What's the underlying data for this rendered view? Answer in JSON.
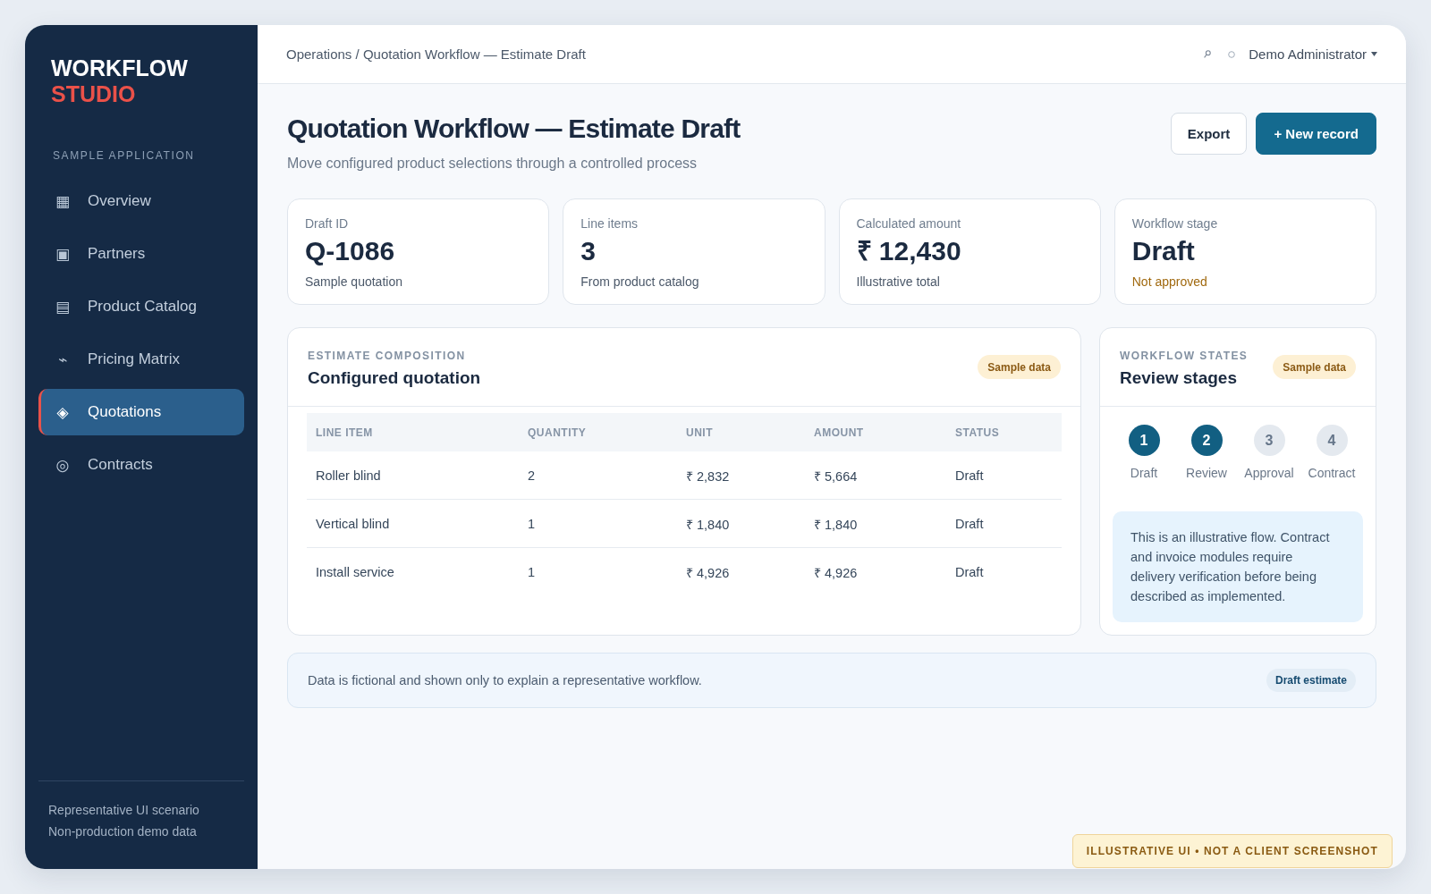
{
  "sidebar": {
    "logo": {
      "primary": "WORKFLOW",
      "accent": "STUDIO"
    },
    "section_label": "SAMPLE APPLICATION",
    "items": [
      {
        "icon": "▦",
        "label": "Overview",
        "selected": false
      },
      {
        "icon": "▣",
        "label": "Partners",
        "selected": false
      },
      {
        "icon": "▤",
        "label": "Product Catalog",
        "selected": false
      },
      {
        "icon": "⌁",
        "label": "Pricing Matrix",
        "selected": false
      },
      {
        "icon": "◈",
        "label": "Quotations",
        "selected": true
      },
      {
        "icon": "◎",
        "label": "Contracts",
        "selected": false
      }
    ],
    "footer": [
      "Representative UI scenario",
      "Non-production demo data"
    ]
  },
  "topbar": {
    "breadcrumb": "Operations / Quotation Workflow — Estimate Draft",
    "user": "Demo Administrator"
  },
  "header": {
    "title": "Quotation Workflow — Estimate Draft",
    "subtitle": "Move configured product selections through a controlled process",
    "buttons": [
      {
        "label": "Export",
        "kind": "secondary"
      },
      {
        "label": "+ New record",
        "kind": "primary"
      }
    ]
  },
  "stats": [
    {
      "label": "Draft ID",
      "value": "Q-1086",
      "note": "Sample quotation",
      "warning": false
    },
    {
      "label": "Line items",
      "value": "3",
      "note": "From product catalog",
      "warning": false
    },
    {
      "label": "Calculated amount",
      "value": "₹ 12,430",
      "note": "Illustrative total",
      "warning": false
    },
    {
      "label": "Workflow stage",
      "value": "Draft",
      "note": "Not approved",
      "warning": true
    }
  ],
  "estimate": {
    "eyebrow": "ESTIMATE COMPOSITION",
    "title": "Configured quotation",
    "badge": "Sample data",
    "table": {
      "columns": [
        "LINE ITEM",
        "QUANTITY",
        "UNIT",
        "AMOUNT",
        "STATUS"
      ],
      "rows": [
        [
          "Roller blind",
          "2",
          "₹ 2,832",
          "₹ 5,664",
          "Draft"
        ],
        [
          "Vertical blind",
          "1",
          "₹ 1,840",
          "₹ 1,840",
          "Draft"
        ],
        [
          "Install service",
          "1",
          "₹ 4,926",
          "₹ 4,926",
          "Draft"
        ]
      ]
    }
  },
  "workflow": {
    "eyebrow": "WORKFLOW STATES",
    "title": "Review stages",
    "badge": "Sample data",
    "steps": [
      {
        "number": "1",
        "label": "Draft",
        "active": true
      },
      {
        "number": "2",
        "label": "Review",
        "active": true
      },
      {
        "number": "3",
        "label": "Approval",
        "active": false
      },
      {
        "number": "4",
        "label": "Contract",
        "active": false
      }
    ],
    "note": "This is an illustrative flow. Contract and invoice modules require delivery verification before being described as implemented."
  },
  "notice": {
    "text": "Data is fictional and shown only to explain a representative workflow.",
    "badge": "Draft estimate"
  },
  "disclaimer": "ILLUSTRATIVE UI • NOT A CLIENT SCREENSHOT"
}
